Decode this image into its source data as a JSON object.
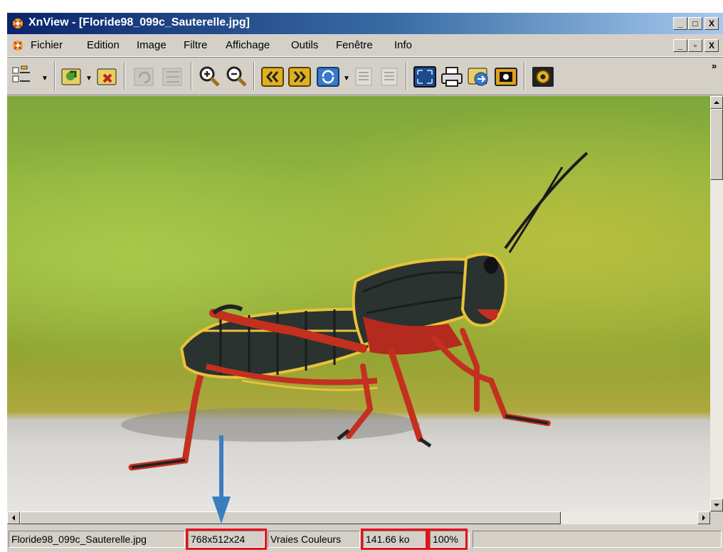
{
  "window": {
    "title": "XnView - [Floride98_099c_Sauterelle.jpg]",
    "caption_buttons": [
      "_",
      "□",
      "X"
    ],
    "doc_buttons": [
      "_",
      "▫",
      "X"
    ]
  },
  "menu": {
    "items": [
      "Fichier",
      "Edition",
      "Image",
      "Filtre",
      "Affichage",
      "Outils",
      "Fenêtre",
      "Info"
    ]
  },
  "toolbar": {
    "buttons": [
      {
        "icon": "browser-icon",
        "enabled": true
      },
      {
        "icon": "open-icon",
        "enabled": true
      },
      {
        "icon": "save-icon",
        "enabled": true
      },
      {
        "icon": "undo-icon",
        "enabled": false
      },
      {
        "icon": "redo-icon",
        "enabled": false
      },
      {
        "icon": "zoom-in-icon",
        "enabled": true
      },
      {
        "icon": "zoom-out-icon",
        "enabled": true
      },
      {
        "icon": "previous-image-icon",
        "enabled": true
      },
      {
        "icon": "next-image-icon",
        "enabled": true
      },
      {
        "icon": "refresh-icon",
        "enabled": true
      },
      {
        "icon": "page-prev-icon",
        "enabled": false
      },
      {
        "icon": "page-next-icon",
        "enabled": false
      },
      {
        "icon": "fullscreen-icon",
        "enabled": true
      },
      {
        "icon": "print-icon",
        "enabled": true
      },
      {
        "icon": "convert-icon",
        "enabled": true
      },
      {
        "icon": "capture-icon",
        "enabled": true
      },
      {
        "icon": "settings-icon",
        "enabled": true
      }
    ],
    "overflow": "»"
  },
  "statusbar": {
    "filename": "Floride98_099c_Sauterelle.jpg",
    "dimensions": "768x512x24",
    "color_mode": "Vraies Couleurs",
    "file_size": "141.66 ko",
    "zoom": "100%"
  },
  "colors": {
    "titlebar_start": "#0a246a",
    "highlight_box": "#e8101a",
    "annotation_arrow": "#3a7ec0"
  }
}
